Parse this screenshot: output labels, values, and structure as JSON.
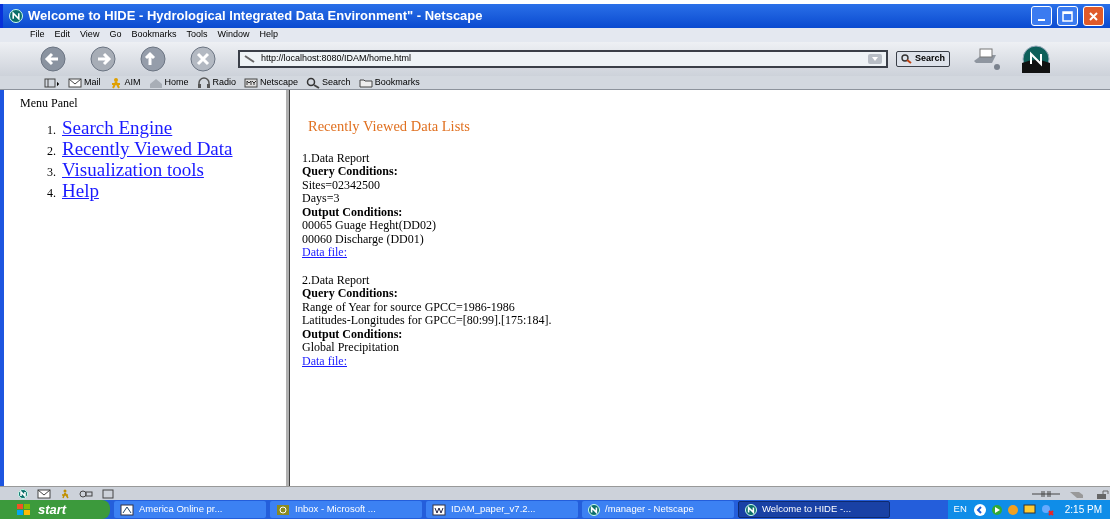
{
  "window": {
    "title": "Welcome to HIDE - Hydrological Integrated Data Environment\" - Netscape"
  },
  "menu": [
    "File",
    "Edit",
    "View",
    "Go",
    "Bookmarks",
    "Tools",
    "Window",
    "Help"
  ],
  "address": {
    "value": "http://localhost:8080/IDAM/home.html"
  },
  "search_button": "Search",
  "personal_toolbar": [
    {
      "label": "Mail",
      "kind": "mail"
    },
    {
      "label": "AIM",
      "kind": "aim"
    },
    {
      "label": "Home",
      "kind": "home"
    },
    {
      "label": "Radio",
      "kind": "radio"
    },
    {
      "label": "Netscape",
      "kind": "my"
    },
    {
      "label": "Search",
      "kind": "search"
    },
    {
      "label": "Bookmarks",
      "kind": "folder"
    }
  ],
  "menu_panel": {
    "title": "Menu Panel",
    "items": [
      {
        "number": "1.",
        "label": "Search Engine"
      },
      {
        "number": "2.",
        "label": "Recently Viewed Data"
      },
      {
        "number": "3.",
        "label": "Visualization tools"
      },
      {
        "number": "4.",
        "label": "Help"
      }
    ]
  },
  "content": {
    "heading": "Recently Viewed Data Lists",
    "reports": [
      {
        "lines": [
          {
            "kind": "plain",
            "text": "1.Data Report"
          },
          {
            "kind": "bold",
            "text": "Query Conditions:"
          },
          {
            "kind": "plain",
            "text": "Sites=02342500"
          },
          {
            "kind": "plain",
            "text": "Days=3"
          },
          {
            "kind": "bold",
            "text": "Output Conditions:"
          },
          {
            "kind": "plain",
            "text": "00065 Guage Heght(DD02)"
          },
          {
            "kind": "plain",
            "text": "00060 Discharge (DD01)"
          },
          {
            "kind": "link",
            "text": "Data file:"
          }
        ]
      },
      {
        "lines": [
          {
            "kind": "plain",
            "text": "2.Data Report"
          },
          {
            "kind": "bold",
            "text": "Query Conditions:"
          },
          {
            "kind": "plain",
            "text": "Range of Year for source GPCC=1986-1986"
          },
          {
            "kind": "plain",
            "text": "Latitudes-Longitudes for GPCC=[80:99].[175:184]."
          },
          {
            "kind": "bold",
            "text": "Output Conditions:"
          },
          {
            "kind": "plain",
            "text": "Global Precipitation"
          },
          {
            "kind": "link",
            "text": "Data file:"
          }
        ]
      }
    ]
  },
  "taskbar": {
    "start": "start",
    "tasks": [
      {
        "label": "America  Online pr...",
        "selected": false
      },
      {
        "label": "Inbox - Microsoft ...",
        "selected": false
      },
      {
        "label": "IDAM_paper_v7.2...",
        "selected": false
      },
      {
        "label": "/manager - Netscape",
        "selected": false
      },
      {
        "label": "Welcome to HIDE -...",
        "selected": true
      }
    ],
    "language": "EN",
    "clock": "2:15 PM"
  }
}
